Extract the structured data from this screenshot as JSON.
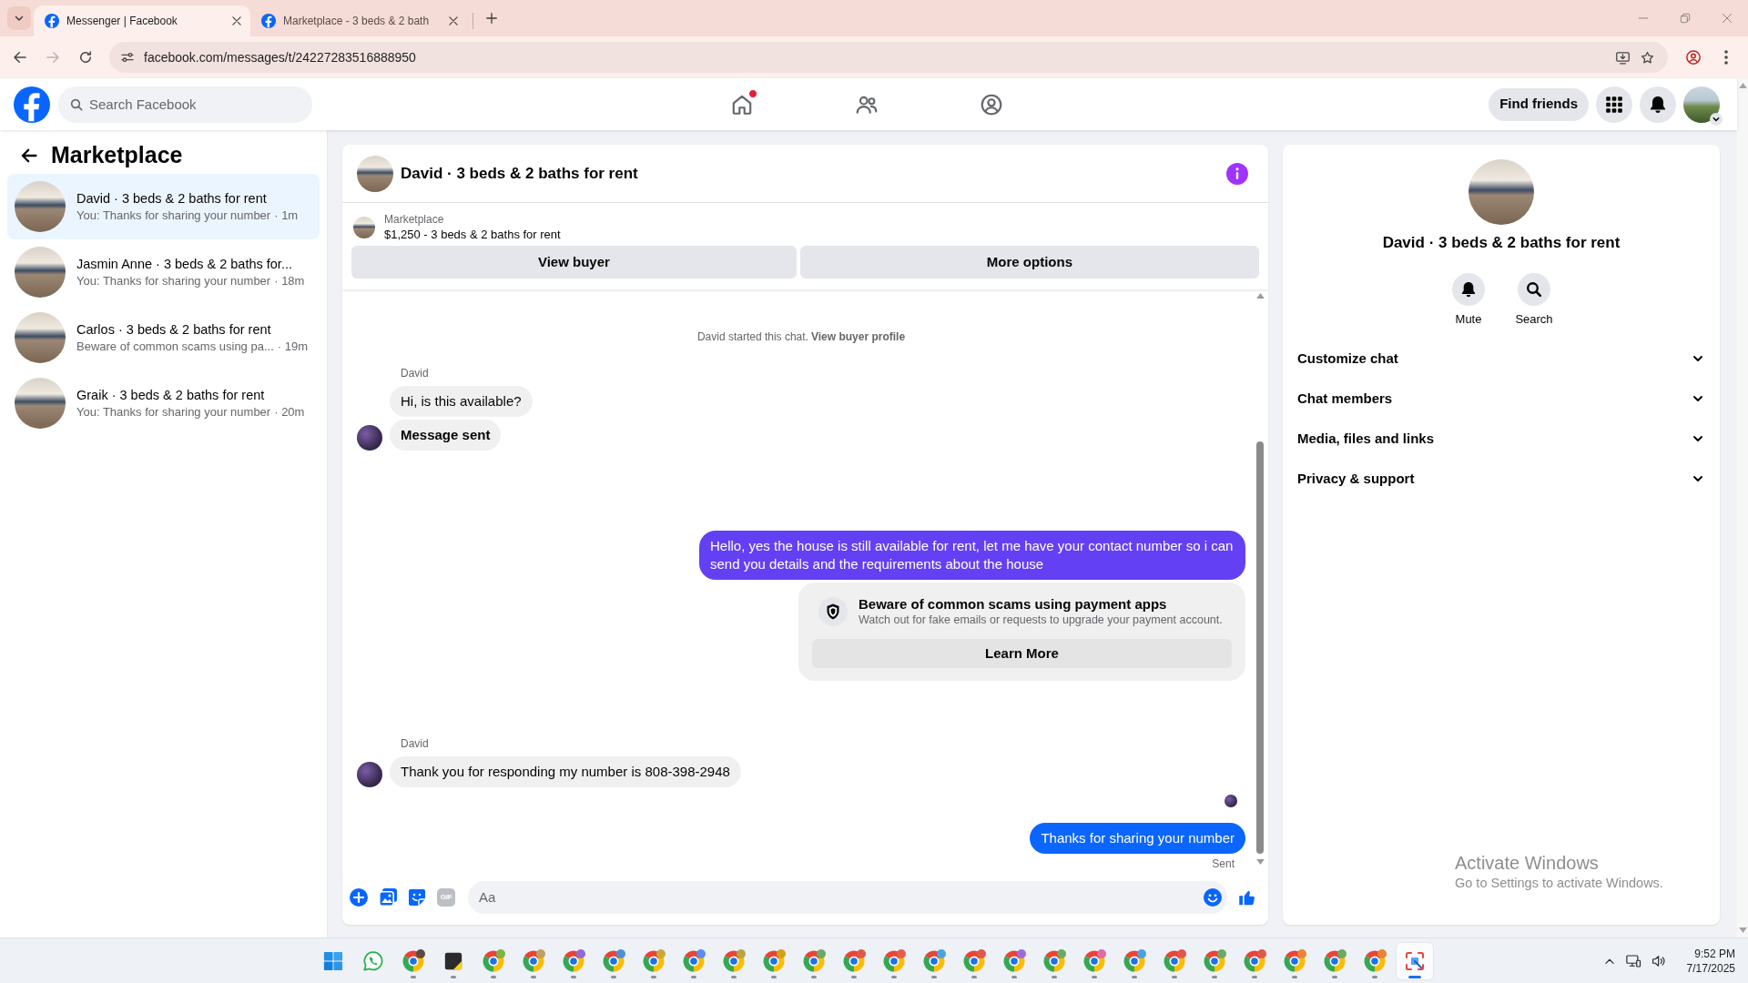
{
  "browser": {
    "tabs": [
      {
        "title": "Messenger | Facebook",
        "selected": true
      },
      {
        "title": "Marketplace - 3 beds & 2 bath",
        "selected": false
      }
    ],
    "nav_buttons": [
      {
        "kind": "back",
        "disabled": false
      },
      {
        "kind": "forward",
        "disabled": true
      },
      {
        "kind": "reload",
        "disabled": false
      }
    ],
    "url": "facebook.com/messages/t/24227283516888950"
  },
  "top_nav": {
    "search_placeholder": "Search Facebook",
    "tabs": [
      {
        "kind": "home",
        "notification": true
      },
      {
        "kind": "friends",
        "notification": false
      },
      {
        "kind": "profile",
        "notification": false
      }
    ],
    "find_friends": "Find friends"
  },
  "sidebar": {
    "title": "Marketplace",
    "conversations": [
      {
        "name": "David · 3 beds & 2 baths for rent",
        "preview": "You: Thanks for sharing your number",
        "time": "· 1m",
        "selected": true
      },
      {
        "name": "Jasmin Anne · 3 beds & 2 baths for...",
        "preview": "You: Thanks for sharing your number",
        "time": "· 18m",
        "selected": false
      },
      {
        "name": "Carlos · 3 beds & 2 baths for rent",
        "preview": "Beware of common scams using pa...",
        "time": "· 19m",
        "selected": false
      },
      {
        "name": "Graik · 3 beds & 2 baths for rent",
        "preview": "You: Thanks for sharing your number",
        "time": "· 20m",
        "selected": false
      }
    ]
  },
  "chat": {
    "title": "David · 3 beds & 2 baths for rent",
    "listing": {
      "label": "Marketplace",
      "text": "$1,250 - 3 beds & 2 baths for rent"
    },
    "actions": [
      "View buyer",
      "More options"
    ],
    "notice": {
      "text": "David started this chat.",
      "link": "View buyer profile"
    },
    "messages": [
      {
        "kind": "incoming",
        "sender": "David",
        "bubbles": [
          {
            "text": "Hi, is this available?",
            "bold": false
          },
          {
            "text": "Message sent",
            "bold": true
          }
        ]
      },
      {
        "kind": "outgoing",
        "seen": false,
        "bubbles": [
          {
            "text": "Hello, yes the house is still available for rent, let me have your contact number so i can send you details and the requirements about the house",
            "color": "#6440f5"
          }
        ]
      },
      {
        "kind": "scam-warning",
        "title": "Beware of common scams using payment apps",
        "text": "Watch out for fake emails or requests to upgrade your payment account.",
        "button": "Learn More"
      },
      {
        "kind": "incoming",
        "sender": "David",
        "bubbles": [
          {
            "text": "Thank you for responding my number is 808-398-2948",
            "bold": false
          }
        ]
      },
      {
        "kind": "outgoing",
        "seen": true,
        "bubbles": [
          {
            "text": "Thanks for sharing your number",
            "color": "#0a66ff"
          }
        ],
        "status": "Sent"
      }
    ],
    "composer": {
      "tools": [
        {
          "kind": "plus"
        },
        {
          "kind": "image"
        },
        {
          "kind": "sticker"
        },
        {
          "kind": "gif",
          "label": "GIF"
        }
      ],
      "placeholder": "Aa"
    }
  },
  "details": {
    "name": "David · 3 beds & 2 baths for rent",
    "actions": [
      {
        "kind": "mute",
        "label": "Mute"
      },
      {
        "kind": "search",
        "label": "Search"
      }
    ],
    "sections": [
      {
        "label": "Customize chat",
        "expanded": false
      },
      {
        "label": "Chat members",
        "expanded": false
      },
      {
        "label": "Media, files and links",
        "expanded": false
      },
      {
        "label": "Privacy & support",
        "expanded": false
      }
    ]
  },
  "windows_notice": {
    "title": "Activate Windows",
    "text": "Go to Settings to activate Windows."
  },
  "taskbar": {
    "apps": [
      {
        "kind": "start",
        "running": false,
        "selected": false
      },
      {
        "kind": "whatsapp",
        "running": false,
        "selected": false
      },
      {
        "kind": "chrome",
        "color": "#5b4a40",
        "running": true,
        "selected": false
      },
      {
        "kind": "notes",
        "running": true,
        "selected": false
      },
      {
        "kind": "chrome",
        "color": "#7cb342",
        "running": true,
        "selected": false
      },
      {
        "kind": "chrome",
        "color": "#c0a060",
        "running": true,
        "selected": false
      },
      {
        "kind": "chrome",
        "color": "#8e6bd6",
        "running": true,
        "selected": false
      },
      {
        "kind": "chrome",
        "color": "#4a90d9",
        "running": true,
        "selected": false
      },
      {
        "kind": "chrome",
        "color": "#c9a83a",
        "running": true,
        "selected": false
      },
      {
        "kind": "chrome",
        "color": "#5b8def",
        "running": true,
        "selected": false
      },
      {
        "kind": "chrome",
        "color": "#b5a642",
        "running": true,
        "selected": false
      },
      {
        "kind": "chrome",
        "color": "#d4a017",
        "running": true,
        "selected": false
      },
      {
        "kind": "chrome",
        "color": "#6aaa64",
        "running": true,
        "selected": false
      },
      {
        "kind": "chrome",
        "color": "#e0584a",
        "running": true,
        "selected": false
      },
      {
        "kind": "chrome",
        "color": "#e35d4f",
        "running": true,
        "selected": false
      },
      {
        "kind": "chrome",
        "color": "#4aa3df",
        "running": true,
        "selected": false
      },
      {
        "kind": "chrome",
        "color": "#e0584a",
        "running": true,
        "selected": false
      },
      {
        "kind": "chrome",
        "color": "#9c6ade",
        "running": true,
        "selected": false
      },
      {
        "kind": "chrome",
        "color": "#6aaa64",
        "running": true,
        "selected": false
      },
      {
        "kind": "chrome",
        "color": "#e06aa8",
        "running": true,
        "selected": false
      },
      {
        "kind": "chrome",
        "color": "#4aa3df",
        "running": true,
        "selected": false
      },
      {
        "kind": "chrome",
        "color": "#e0584a",
        "running": true,
        "selected": false
      },
      {
        "kind": "chrome",
        "color": "#6aaa64",
        "running": true,
        "selected": false
      },
      {
        "kind": "chrome",
        "color": "#e0584a",
        "running": true,
        "selected": false
      },
      {
        "kind": "chrome",
        "color": "#e8833a",
        "running": true,
        "selected": false
      },
      {
        "kind": "chrome",
        "color": "#6aaa64",
        "running": true,
        "selected": false
      },
      {
        "kind": "chrome",
        "color": "#e8833a",
        "running": true,
        "selected": false
      },
      {
        "kind": "snip",
        "running": true,
        "selected": true
      }
    ],
    "clock": {
      "time": "9:52 PM",
      "date": "7/17/2025"
    }
  }
}
